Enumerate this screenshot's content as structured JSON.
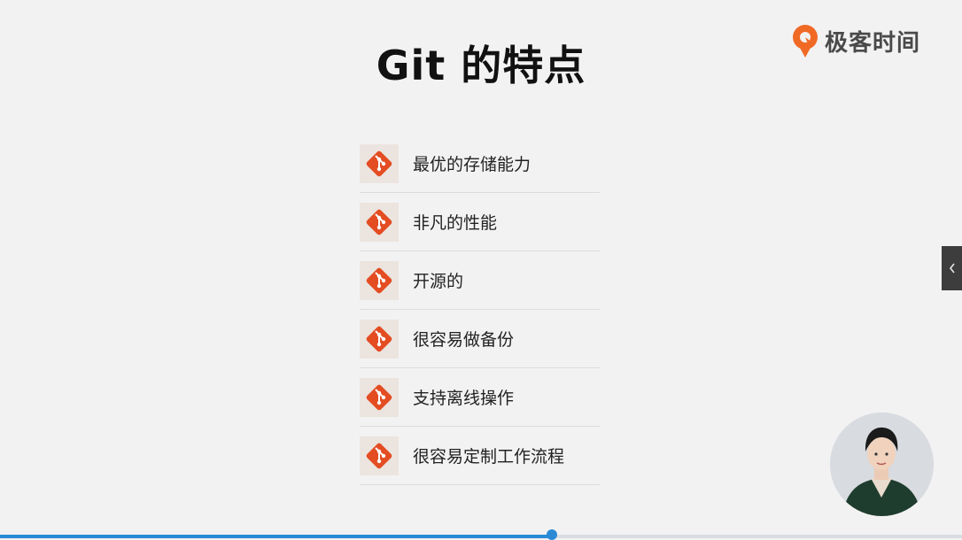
{
  "slide": {
    "title": "Git 的特点"
  },
  "brand": {
    "name": "极客时间",
    "icon": "geektime-logo-icon",
    "color": "#f06a26"
  },
  "features": [
    {
      "label": "最优的存储能力",
      "icon": "git-icon"
    },
    {
      "label": "非凡的性能",
      "icon": "git-icon"
    },
    {
      "label": "开源的",
      "icon": "git-icon"
    },
    {
      "label": "很容易做备份",
      "icon": "git-icon"
    },
    {
      "label": "支持离线操作",
      "icon": "git-icon"
    },
    {
      "label": "很容易定制工作流程",
      "icon": "git-icon"
    }
  ],
  "colors": {
    "git_orange": "#e44c22",
    "progress_blue": "#2a8ad6"
  },
  "player": {
    "progress": 0.574,
    "side_tab_icon": "chevron-left-icon"
  }
}
